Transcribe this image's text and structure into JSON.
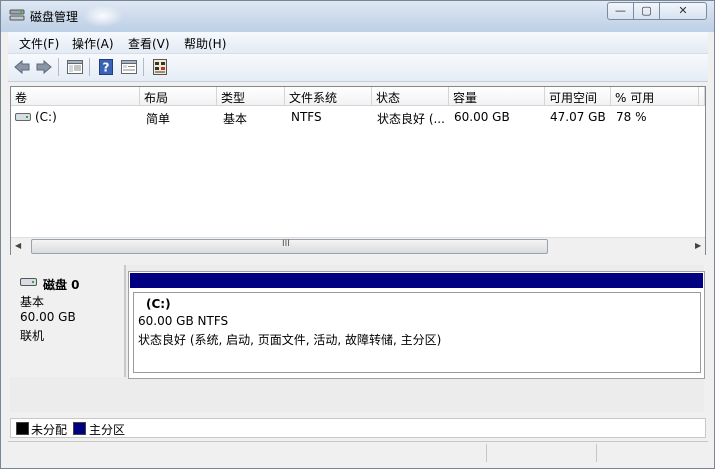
{
  "window": {
    "title": "磁盘管理",
    "controls": {
      "minimize": "—",
      "maximize": "▢",
      "close": "✕"
    }
  },
  "menubar": {
    "items": [
      {
        "label": "文件(F)"
      },
      {
        "label": "操作(A)"
      },
      {
        "label": "查看(V)"
      },
      {
        "label": "帮助(H)"
      }
    ]
  },
  "toolbar": {
    "buttons": [
      {
        "icon": "back-arrow-icon"
      },
      {
        "icon": "forward-arrow-icon"
      },
      {
        "icon": "show-hide-console-tree-icon"
      },
      {
        "icon": "help-icon"
      },
      {
        "icon": "properties-icon"
      },
      {
        "icon": "disk-settings-icon"
      }
    ]
  },
  "volume_list": {
    "columns": [
      "卷",
      "布局",
      "类型",
      "文件系统",
      "状态",
      "容量",
      "可用空间",
      "% 可用"
    ],
    "rows": [
      {
        "volume": "(C:)",
        "layout": "简单",
        "type": "基本",
        "filesystem": "NTFS",
        "status": "状态良好 (...",
        "capacity": "60.00 GB",
        "free": "47.07 GB",
        "percent_free": "78 %"
      }
    ],
    "scrollbar_grip": "III"
  },
  "disk_map": {
    "disk": {
      "name": "磁盘 0",
      "type": "基本",
      "size": "60.00 GB",
      "state": "联机"
    },
    "partition": {
      "label": "(C:)",
      "size_fs": "60.00 GB NTFS",
      "status": "状态良好 (系统, 启动, 页面文件, 活动, 故障转储, 主分区)",
      "bar_color": "#000080"
    }
  },
  "legend": {
    "items": [
      {
        "label": "未分配",
        "color": "#000000"
      },
      {
        "label": "主分区",
        "color": "#000080"
      }
    ]
  }
}
